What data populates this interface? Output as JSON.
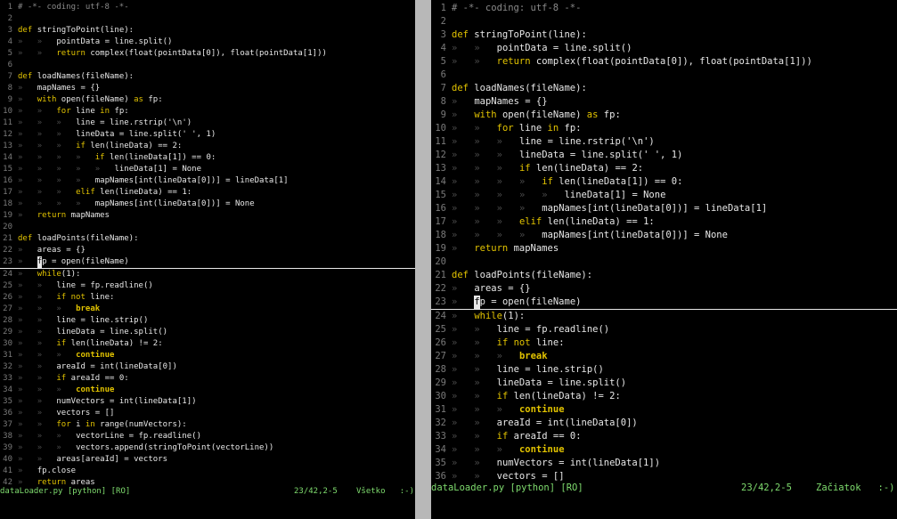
{
  "code": [
    {
      "n": "1",
      "t": "# -*- coding: utf-8 -*-"
    },
    {
      "n": "2",
      "t": ""
    },
    {
      "n": "3",
      "t": "def stringToPoint(line):"
    },
    {
      "n": "4",
      "t": "»   »   pointData = line.split()"
    },
    {
      "n": "5",
      "t": "»   »   return complex(float(pointData[0]), float(pointData[1]))"
    },
    {
      "n": "6",
      "t": ""
    },
    {
      "n": "7",
      "t": "def loadNames(fileName):"
    },
    {
      "n": "8",
      "t": "»   mapNames = {}"
    },
    {
      "n": "9",
      "t": "»   with open(fileName) as fp:"
    },
    {
      "n": "10",
      "t": "»   »   for line in fp:"
    },
    {
      "n": "11",
      "t": "»   »   »   line = line.rstrip('\\n')"
    },
    {
      "n": "12",
      "t": "»   »   »   lineData = line.split(' ', 1)"
    },
    {
      "n": "13",
      "t": "»   »   »   if len(lineData) == 2:"
    },
    {
      "n": "14",
      "t": "»   »   »   »   if len(lineData[1]) == 0:"
    },
    {
      "n": "15",
      "t": "»   »   »   »   »   lineData[1] = None"
    },
    {
      "n": "16",
      "t": "»   »   »   »   mapNames[int(lineData[0])] = lineData[1]"
    },
    {
      "n": "17",
      "t": "»   »   »   elif len(lineData) == 1:"
    },
    {
      "n": "18",
      "t": "»   »   »   »   mapNames[int(lineData[0])] = None"
    },
    {
      "n": "19",
      "t": "»   return mapNames"
    },
    {
      "n": "20",
      "t": ""
    },
    {
      "n": "21",
      "t": "def loadPoints(fileName):"
    },
    {
      "n": "22",
      "t": "»   areas = {}"
    },
    {
      "n": "23",
      "t": "»   fp = open(fileName)"
    },
    {
      "n": "24",
      "t": "»   while(1):"
    },
    {
      "n": "25",
      "t": "»   »   line = fp.readline()"
    },
    {
      "n": "26",
      "t": "»   »   if not line:"
    },
    {
      "n": "27",
      "t": "»   »   »   break"
    },
    {
      "n": "28",
      "t": "»   »   line = line.strip()"
    },
    {
      "n": "29",
      "t": "»   »   lineData = line.split()"
    },
    {
      "n": "30",
      "t": "»   »   if len(lineData) != 2:"
    },
    {
      "n": "31",
      "t": "»   »   »   continue"
    },
    {
      "n": "32",
      "t": "»   »   areaId = int(lineData[0])"
    },
    {
      "n": "33",
      "t": "»   »   if areaId == 0:"
    },
    {
      "n": "34",
      "t": "»   »   »   continue"
    },
    {
      "n": "35",
      "t": "»   »   numVectors = int(lineData[1])"
    },
    {
      "n": "36",
      "t": "»   »   vectors = []"
    },
    {
      "n": "37",
      "t": "»   »   for i in range(numVectors):"
    },
    {
      "n": "38",
      "t": "»   »   »   vectorLine = fp.readline()"
    },
    {
      "n": "39",
      "t": "»   »   »   vectors.append(stringToPoint(vectorLine))"
    },
    {
      "n": "40",
      "t": "»   »   areas[areaId] = vectors"
    },
    {
      "n": "41",
      "t": "»   fp.close"
    },
    {
      "n": "42",
      "t": "»   return areas"
    }
  ],
  "cursor_line": 23,
  "left_pane": {
    "visible_lines": 42,
    "status": {
      "file": "dataLoader.py [python] [RO]",
      "position": "23/42,2-5",
      "mode": "Všetko   :-)"
    }
  },
  "right_pane": {
    "visible_lines": 36,
    "status": {
      "file": "dataLoader.py [python] [RO]",
      "position": "23/42,2-5",
      "mode": "Začiatok   :-)"
    }
  },
  "colors": {
    "background": "#000000",
    "text": "#e8e8e8",
    "keyword": "#e2c300",
    "line_number": "#7a7a7a",
    "status": "#7fdc6e",
    "separator": "#b8b8b8"
  }
}
